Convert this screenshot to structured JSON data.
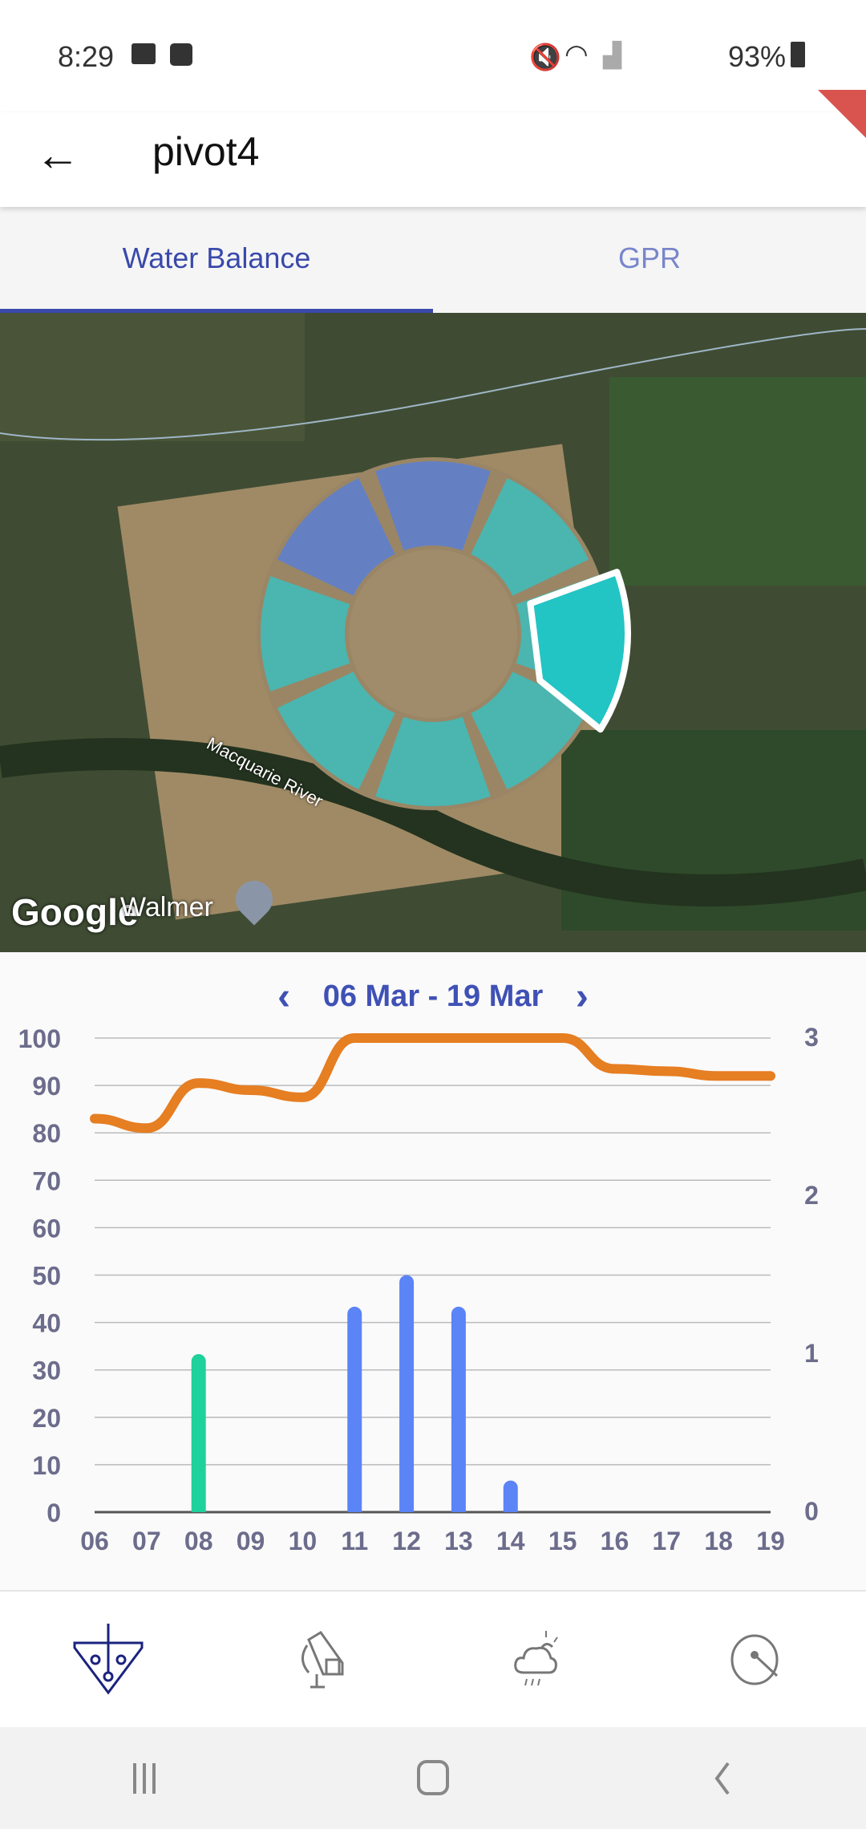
{
  "status_bar": {
    "time": "8:29",
    "battery": "93%",
    "icons": [
      "image-icon",
      "alarm-icon",
      "mute-icon",
      "wifi-icon",
      "signal-icon",
      "battery-charging-icon"
    ]
  },
  "app_bar": {
    "title": "pivot4",
    "back_icon": "arrow-left-icon"
  },
  "tabs": [
    {
      "label": "Water Balance",
      "active": true
    },
    {
      "label": "GPR",
      "active": false
    }
  ],
  "map": {
    "labels": {
      "river": "Macquarie River",
      "place": "Walmer",
      "attribution": "Google"
    },
    "segment_colors": {
      "blue": "#5b7fd4",
      "teal": "#3dbdbd",
      "selected": "#22c4c4"
    }
  },
  "chart": {
    "date_range": "06 Mar - 19 Mar"
  },
  "chart_data": {
    "type": "bar+line",
    "x": [
      "06",
      "07",
      "08",
      "09",
      "10",
      "11",
      "12",
      "13",
      "14",
      "15",
      "16",
      "17",
      "18",
      "19"
    ],
    "left_axis": {
      "ticks": [
        "0",
        "10",
        "20",
        "30",
        "40",
        "50",
        "60",
        "70",
        "80",
        "90",
        "100"
      ],
      "range": [
        0,
        100
      ]
    },
    "right_axis": {
      "ticks": [
        "0",
        "1",
        "2",
        "3"
      ],
      "range": [
        0,
        3
      ]
    },
    "line": {
      "axis": "left",
      "color": "#e67e22",
      "values": [
        83,
        81,
        90.5,
        89,
        87.5,
        100,
        100,
        100,
        100,
        100,
        93.5,
        93,
        92,
        92
      ]
    },
    "bars": {
      "axis": "right",
      "values": [
        0,
        0,
        1.0,
        0,
        0,
        1.3,
        1.5,
        1.3,
        0.2,
        0,
        0,
        0,
        0,
        0
      ],
      "colors": [
        "#5b84f7",
        "#5b84f7",
        "#1fd19a",
        "#5b84f7",
        "#5b84f7",
        "#5b84f7",
        "#5b84f7",
        "#5b84f7",
        "#5b84f7",
        "#5b84f7",
        "#5b84f7",
        "#5b84f7",
        "#5b84f7",
        "#5b84f7"
      ]
    },
    "grid": true
  },
  "bottom_nav": [
    {
      "icon": "soil-probe-icon",
      "active": true
    },
    {
      "icon": "irrigation-sprinkler-icon",
      "active": false
    },
    {
      "icon": "weather-icon",
      "active": false
    },
    {
      "icon": "pivot-icon",
      "active": false
    }
  ],
  "system_nav": [
    "recent-apps-icon",
    "home-icon",
    "back-icon"
  ]
}
